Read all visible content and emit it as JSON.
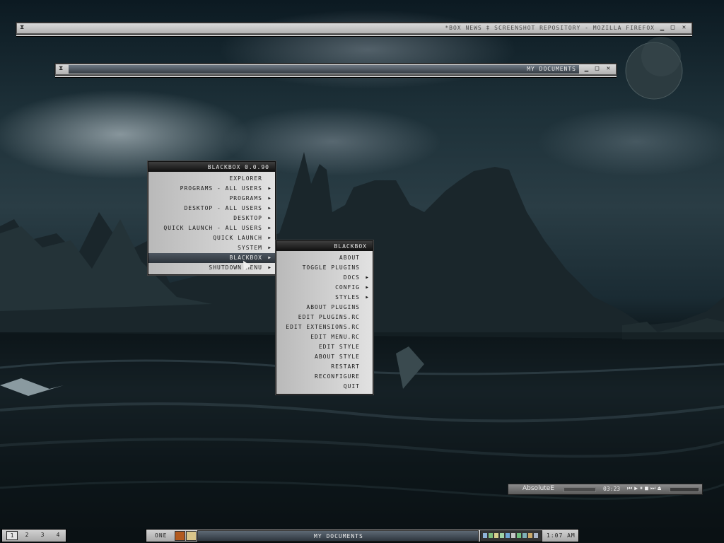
{
  "firefox_window": {
    "title": "*BOX NEWS ‡ SCREENSHOT REPOSITORY - MOZILLA FIREFOX",
    "icon": "hourglass-icon"
  },
  "documents_window": {
    "title": "MY DOCUMENTS",
    "icon": "hourglass-icon"
  },
  "main_menu": {
    "title": "BLACKBOX 0.0.90",
    "items": [
      {
        "label": "EXPLORER",
        "submenu": false
      },
      {
        "label": "PROGRAMS - ALL USERS",
        "submenu": true
      },
      {
        "label": "PROGRAMS",
        "submenu": true
      },
      {
        "label": "DESKTOP - ALL USERS",
        "submenu": true
      },
      {
        "label": "DESKTOP",
        "submenu": true
      },
      {
        "label": "QUICK LAUNCH - ALL USERS",
        "submenu": true
      },
      {
        "label": "QUICK LAUNCH",
        "submenu": true
      },
      {
        "label": "SYSTEM",
        "submenu": true
      },
      {
        "label": "BLACKBOX",
        "submenu": true,
        "selected": true
      },
      {
        "label": "SHUTDOWN MENU",
        "submenu": true
      }
    ]
  },
  "sub_menu": {
    "title": "BLACKBOX",
    "items": [
      {
        "label": "ABOUT",
        "submenu": false
      },
      {
        "label": "TOGGLE PLUGINS",
        "submenu": false
      },
      {
        "label": "DOCS",
        "submenu": true
      },
      {
        "label": "CONFIG",
        "submenu": true
      },
      {
        "label": "STYLES",
        "submenu": true
      },
      {
        "label": "ABOUT PLUGINS",
        "submenu": false
      },
      {
        "label": "EDIT PLUGINS.RC",
        "submenu": false
      },
      {
        "label": "EDIT EXTENSIONS.RC",
        "submenu": false
      },
      {
        "label": "EDIT MENU.RC",
        "submenu": false
      },
      {
        "label": "EDIT STYLE",
        "submenu": false
      },
      {
        "label": "ABOUT STYLE",
        "submenu": false
      },
      {
        "label": "RESTART",
        "submenu": false
      },
      {
        "label": "RECONFIGURE",
        "submenu": false
      },
      {
        "label": "QUIT",
        "submenu": false
      }
    ]
  },
  "player": {
    "name": "AbsoluteE",
    "time": "03:23",
    "controls": [
      "prev-icon",
      "play-icon",
      "pause-icon",
      "stop-icon",
      "next-icon",
      "eject-icon"
    ]
  },
  "workspaces": [
    "1",
    "2",
    "3",
    "4"
  ],
  "active_workspace": "1",
  "taskbar": {
    "workspace_name": "ONE",
    "task_label": "MY DOCUMENTS",
    "clock": "1:07 AM",
    "tray_icons": [
      "tray-icon-1",
      "tray-icon-2",
      "tray-icon-3",
      "tray-icon-4",
      "tray-icon-5",
      "tray-icon-6",
      "tray-icon-7",
      "tray-icon-8",
      "tray-icon-9",
      "tray-icon-10"
    ]
  }
}
